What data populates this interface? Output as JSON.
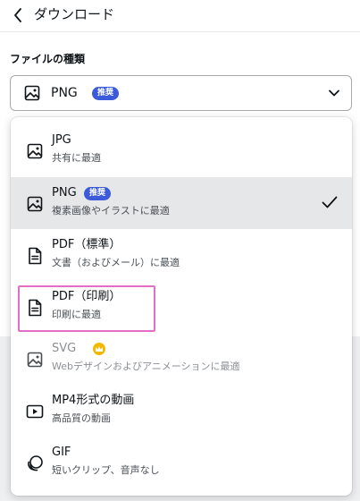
{
  "header": {
    "title": "ダウンロード"
  },
  "file_type": {
    "label": "ファイルの種類",
    "selected_value": "PNG",
    "selected_badge": "推奨"
  },
  "options": [
    {
      "title": "JPG",
      "desc": "共有に最適",
      "icon": "image-icon"
    },
    {
      "title": "PNG",
      "badge": "推奨",
      "desc": "複素画像やイラストに最適",
      "icon": "image-icon",
      "selected": true
    },
    {
      "title": "PDF（標準）",
      "desc": "文書（およびメール）に最適",
      "icon": "document-icon"
    },
    {
      "title": "PDF（印刷）",
      "desc": "印刷に最適",
      "icon": "document-icon"
    },
    {
      "title": "SVG",
      "desc": "Webデザインおよびアニメーションに最適",
      "icon": "image-icon",
      "premium_icon": "crown-icon",
      "disabled": true
    },
    {
      "title": "MP4形式の動画",
      "desc": "高品質の動画",
      "icon": "video-icon"
    },
    {
      "title": "GIF",
      "desc": "短いクリップ、音声なし",
      "icon": "gif-icon"
    }
  ],
  "colors": {
    "badge": "#3b5bdb",
    "selected_row": "#e6e7e9",
    "highlight": "#e26fc3",
    "premium": "#f5b700"
  }
}
